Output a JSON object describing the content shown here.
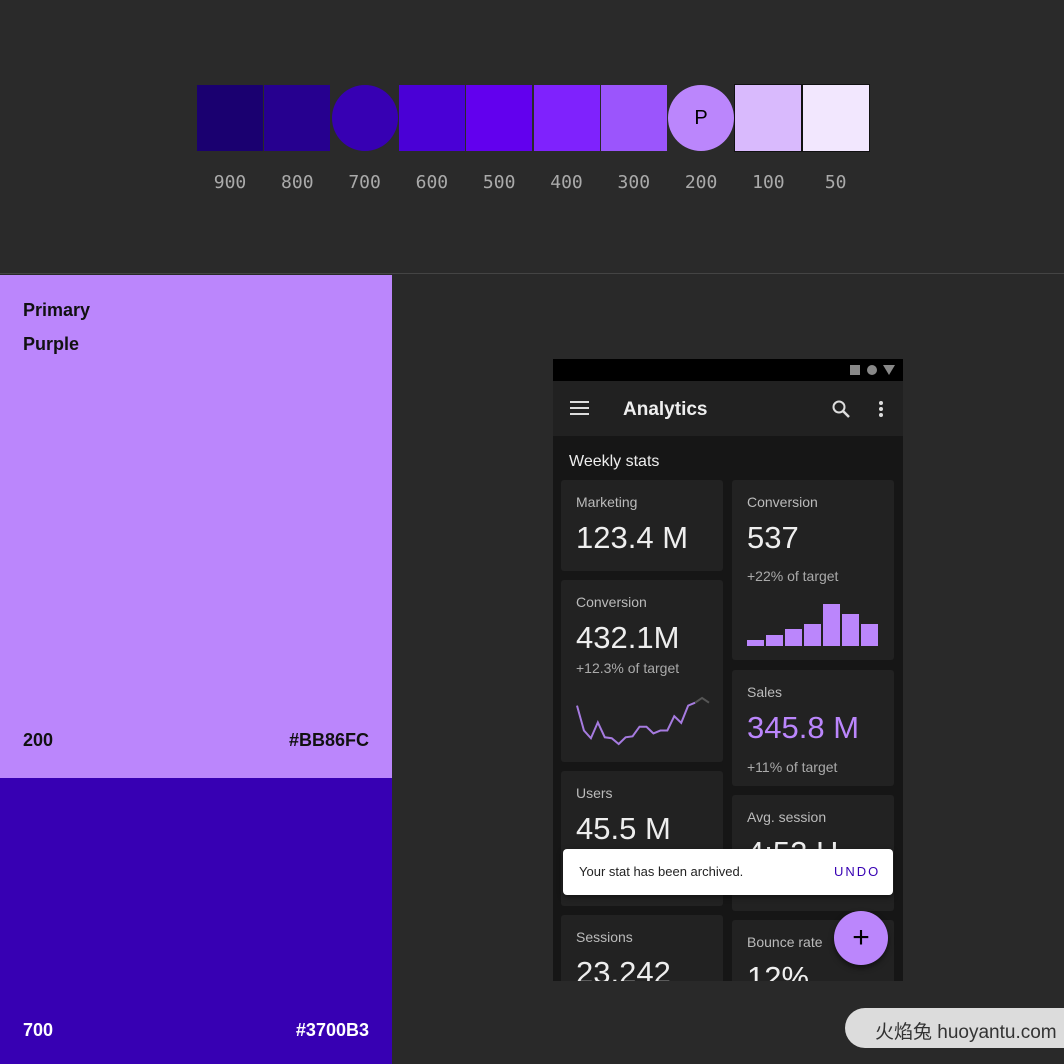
{
  "palette": [
    {
      "label": "900",
      "color": "#1A0070",
      "shape": "square",
      "letter": ""
    },
    {
      "label": "800",
      "color": "#26008F",
      "shape": "square",
      "letter": ""
    },
    {
      "label": "700",
      "color": "#3700B3",
      "shape": "circle",
      "letter": ""
    },
    {
      "label": "600",
      "color": "#4A00D6",
      "shape": "square",
      "letter": ""
    },
    {
      "label": "500",
      "color": "#6200EE",
      "shape": "square",
      "letter": ""
    },
    {
      "label": "400",
      "color": "#7F22FD",
      "shape": "square",
      "letter": ""
    },
    {
      "label": "300",
      "color": "#9B55FC",
      "shape": "square",
      "letter": ""
    },
    {
      "label": "200",
      "color": "#BB86FC",
      "shape": "circle",
      "letter": "P"
    },
    {
      "label": "100",
      "color": "#D9BAFD",
      "shape": "square",
      "letter": ""
    },
    {
      "label": "50",
      "color": "#F2E7FE",
      "shape": "square",
      "letter": ""
    }
  ],
  "primary": {
    "line1": "Primary",
    "line2": "Purple",
    "tone": "200",
    "hex": "#BB86FC",
    "color": "#BB86FC"
  },
  "dark": {
    "tone": "700",
    "hex": "#3700B3",
    "color": "#3700B3"
  },
  "app": {
    "title": "Analytics",
    "section": "Weekly stats",
    "icons": [
      "menu-icon",
      "search-icon",
      "more-vert-icon"
    ],
    "status_icons": [
      "square-icon",
      "circle-icon",
      "triangle-icon"
    ],
    "cards": {
      "marketing": {
        "label": "Marketing",
        "value": "123.4 M"
      },
      "conversion_left": {
        "label": "Conversion",
        "value": "432.1M",
        "sub": "+12.3% of target"
      },
      "users": {
        "label": "Users",
        "value": "45.5 M"
      },
      "sessions": {
        "label": "Sessions",
        "value": "23,242"
      },
      "conversion_right": {
        "label": "Conversion",
        "value": "537",
        "sub": "+22% of target"
      },
      "sales": {
        "label": "Sales",
        "value": "345.8 M",
        "sub": "+11% of target"
      },
      "avg_session": {
        "label": "Avg. session",
        "value": "4:52 H"
      },
      "bounce": {
        "label": "Bounce rate",
        "value": "12%"
      }
    },
    "snackbar": {
      "message": "Your stat has been archived.",
      "action": "UNDO"
    },
    "fab": "+"
  },
  "chart_data": [
    {
      "type": "line",
      "values": [
        80,
        28,
        12,
        45,
        14,
        12,
        0,
        14,
        16,
        36,
        36,
        22,
        28,
        28,
        58,
        44,
        80,
        86,
        96,
        86
      ]
    },
    {
      "type": "bar",
      "values": [
        6,
        11,
        17,
        22,
        42,
        32,
        22
      ]
    }
  ],
  "watermark": "火焰兔 huoyantu.com"
}
